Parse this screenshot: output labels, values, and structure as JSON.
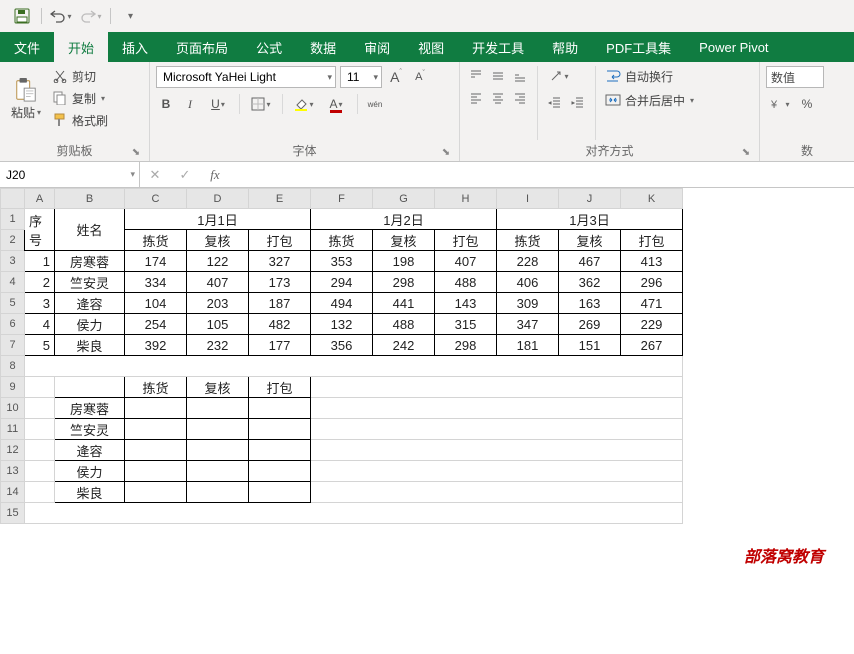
{
  "qat": {
    "save": "save-icon",
    "undo": "undo-icon",
    "redo": "redo-icon"
  },
  "tabs": [
    "文件",
    "开始",
    "插入",
    "页面布局",
    "公式",
    "数据",
    "审阅",
    "视图",
    "开发工具",
    "帮助",
    "PDF工具集",
    "Power Pivot"
  ],
  "activeTab": 1,
  "clipboard": {
    "paste": "粘贴",
    "cut": "剪切",
    "copy": "复制",
    "formatPainter": "格式刷",
    "label": "剪贴板"
  },
  "font": {
    "name": "Microsoft YaHei Light",
    "size": "11",
    "increase": "A",
    "increaseSup": "▲",
    "decrease": "A",
    "decreaseSup": "▼",
    "bold": "B",
    "italic": "I",
    "underline": "U",
    "ruby": "wén",
    "label": "字体"
  },
  "align": {
    "wrap": "自动换行",
    "merge": "合并后居中",
    "label": "对齐方式"
  },
  "number": {
    "format": "数值",
    "percent": "%"
  },
  "namebox": "J20",
  "formula": "",
  "cols": [
    "A",
    "B",
    "C",
    "D",
    "E",
    "F",
    "G",
    "H",
    "I",
    "J",
    "K"
  ],
  "rows": [
    "1",
    "2",
    "3",
    "4",
    "5",
    "6",
    "7",
    "8",
    "9",
    "10",
    "11",
    "12",
    "13",
    "14",
    "15"
  ],
  "head1": {
    "seq": "序号",
    "name": "姓名",
    "d1": "1月1日",
    "d2": "1月2日",
    "d3": "1月3日"
  },
  "head2": {
    "c": "拣货",
    "d": "复核",
    "e": "打包",
    "f": "拣货",
    "g": "复核",
    "h": "打包",
    "i": "拣货",
    "j": "复核",
    "k": "打包"
  },
  "data": [
    {
      "seq": "1",
      "name": "房寒蓉",
      "v": [
        "174",
        "122",
        "327",
        "353",
        "198",
        "407",
        "228",
        "467",
        "413"
      ]
    },
    {
      "seq": "2",
      "name": "竺安灵",
      "v": [
        "334",
        "407",
        "173",
        "294",
        "298",
        "488",
        "406",
        "362",
        "296"
      ]
    },
    {
      "seq": "3",
      "name": "逄容",
      "v": [
        "104",
        "203",
        "187",
        "494",
        "441",
        "143",
        "309",
        "163",
        "471"
      ]
    },
    {
      "seq": "4",
      "name": "侯力",
      "v": [
        "254",
        "105",
        "482",
        "132",
        "488",
        "315",
        "347",
        "269",
        "229"
      ]
    },
    {
      "seq": "5",
      "name": "柴良",
      "v": [
        "392",
        "232",
        "177",
        "356",
        "242",
        "298",
        "181",
        "151",
        "267"
      ]
    }
  ],
  "summaryHead": {
    "c": "拣货",
    "d": "复核",
    "e": "打包"
  },
  "summaryNames": [
    "房寒蓉",
    "竺安灵",
    "逄容",
    "侯力",
    "柴良"
  ],
  "watermark": "部落窝教育"
}
